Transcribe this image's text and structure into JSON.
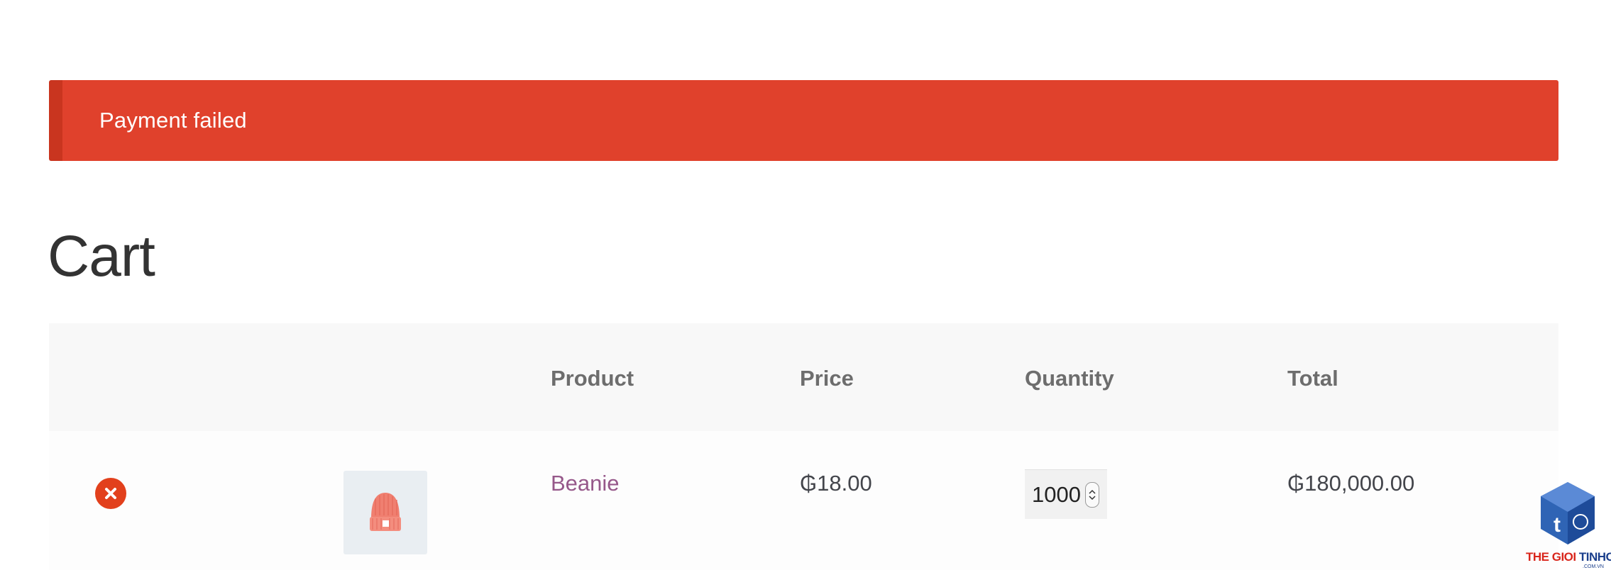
{
  "notice": {
    "message": "Payment failed",
    "color": "#e0412c"
  },
  "page": {
    "title": "Cart"
  },
  "cart": {
    "headers": {
      "product": "Product",
      "price": "Price",
      "quantity": "Quantity",
      "total": "Total"
    },
    "items": [
      {
        "name": "Beanie",
        "price": "₲18.00",
        "quantity": "1000",
        "total": "₲180,000.00",
        "thumbnail_icon": "beanie-hat-icon",
        "remove_icon": "remove-x-icon"
      }
    ]
  },
  "colors": {
    "accent_link": "#96588a",
    "remove": "#e2401c"
  },
  "watermark": {
    "text_part1": "THE GIOI",
    "text_part2": "TINHOC",
    "sub": ".COM.VN"
  }
}
